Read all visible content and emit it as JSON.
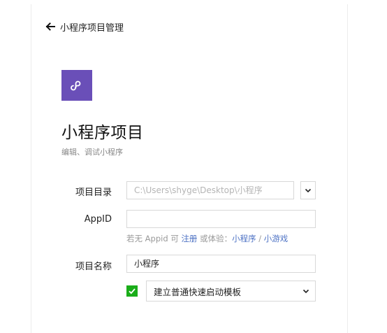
{
  "nav": {
    "back_label": "小程序项目管理"
  },
  "header": {
    "title": "小程序项目",
    "subtitle": "编辑、调试小程序"
  },
  "form": {
    "directory": {
      "label": "项目目录",
      "value": "C:\\Users\\shyge\\Desktop\\小程序"
    },
    "appid": {
      "label": "AppID",
      "value": ""
    },
    "hint": {
      "prefix": "若无 Appid 可",
      "register": "注册",
      "middle": "或体验：",
      "miniprogram": "小程序",
      "separator": "/",
      "minigame": "小游戏"
    },
    "project_name": {
      "label": "项目名称",
      "value": "小程序"
    },
    "template": {
      "checked": true,
      "selected": "建立普通快速启动模板"
    }
  },
  "colors": {
    "logo": "#6a4fb8",
    "checkbox": "#1aad19",
    "link": "#4d72c4"
  },
  "icons": {
    "back": "arrow-left-icon",
    "logo": "miniprogram-logo-icon",
    "dropdown": "chevron-down-icon",
    "check": "check-icon"
  }
}
